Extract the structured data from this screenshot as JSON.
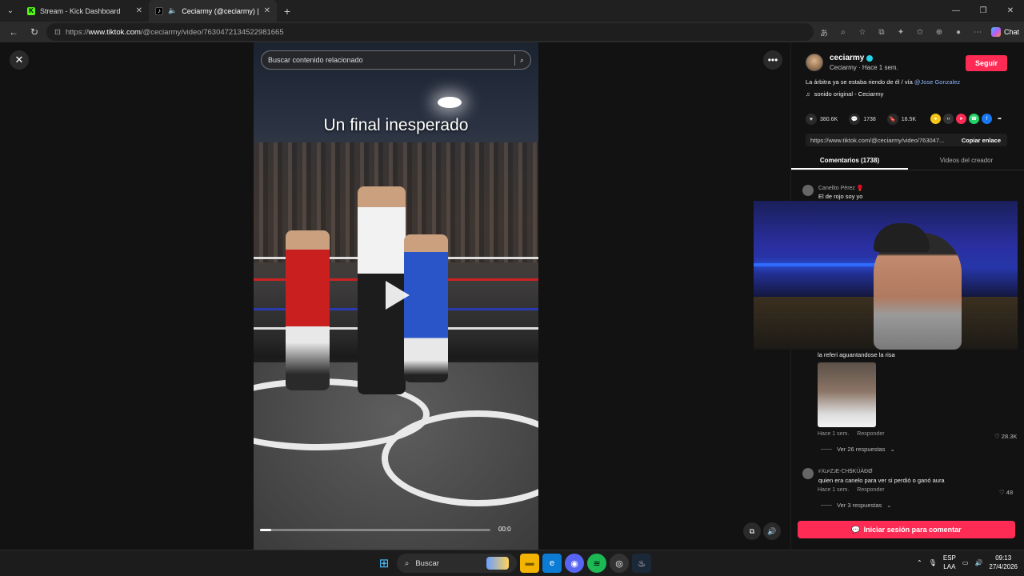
{
  "browser": {
    "tabs": [
      {
        "title": "Stream - Kick Dashboard",
        "favicon": "kick-icon"
      },
      {
        "title": "Ceciarmy (@ceciarmy) | TikTok",
        "favicon": "tiktok-icon"
      }
    ],
    "url_prefix": "https://",
    "url_host": "www.tiktok.com",
    "url_path": "/@ceciarmy/video/7630472134522981665",
    "chat_label": "Chat"
  },
  "video": {
    "search_placeholder": "Buscar contenido relacionado",
    "caption": "Un final inesperado",
    "time": "00:0",
    "progress": 0.05
  },
  "side": {
    "author_name": "ceciarmy",
    "author_sub": "Ceciarmy · Hace 1 sem.",
    "follow_label": "Seguir",
    "description": "La árbitra ya se estaba riendo de él / vía ",
    "mention": "@Jose Gonzalez",
    "music": "sonido original - Ceciarmy",
    "likes": "380.6K",
    "comments": "1738",
    "saves": "16.5K",
    "link": "https://www.tiktok.com/@ceciarmy/video/763047...",
    "copy_label": "Copiar enlace",
    "tab_comments": "Comentarios (1738)",
    "tab_creator": "Videos del creador",
    "comment1": {
      "user": "Canelito Pérez 🥊",
      "text": "El de rojo soy yo"
    },
    "comment2": {
      "text": "la referi aguantandose la risa",
      "time": "Hace 1 sem.",
      "reply": "Responder",
      "likes": "♡ 28.3K",
      "replies": "Ver 26 respuestas"
    },
    "comment3": {
      "user": "ꜰXʟᴘZᴊE-ꞆHꞨKÜÀÐØ",
      "text": "quien era canelo para ver si perdió o ganó aura",
      "time": "Hace 1 sem.",
      "reply": "Responder",
      "likes": "♡ 48",
      "replies": "Ver 3 respuestas"
    },
    "login_label": "Iniciar sesión para comentar"
  },
  "taskbar": {
    "search_label": "Buscar",
    "lang_top": "ESP",
    "lang_bottom": "LAA",
    "time": "09:13",
    "date": "27/4/2026"
  },
  "colors": {
    "accent": "#fe2c55",
    "kick": "#53fc18"
  }
}
